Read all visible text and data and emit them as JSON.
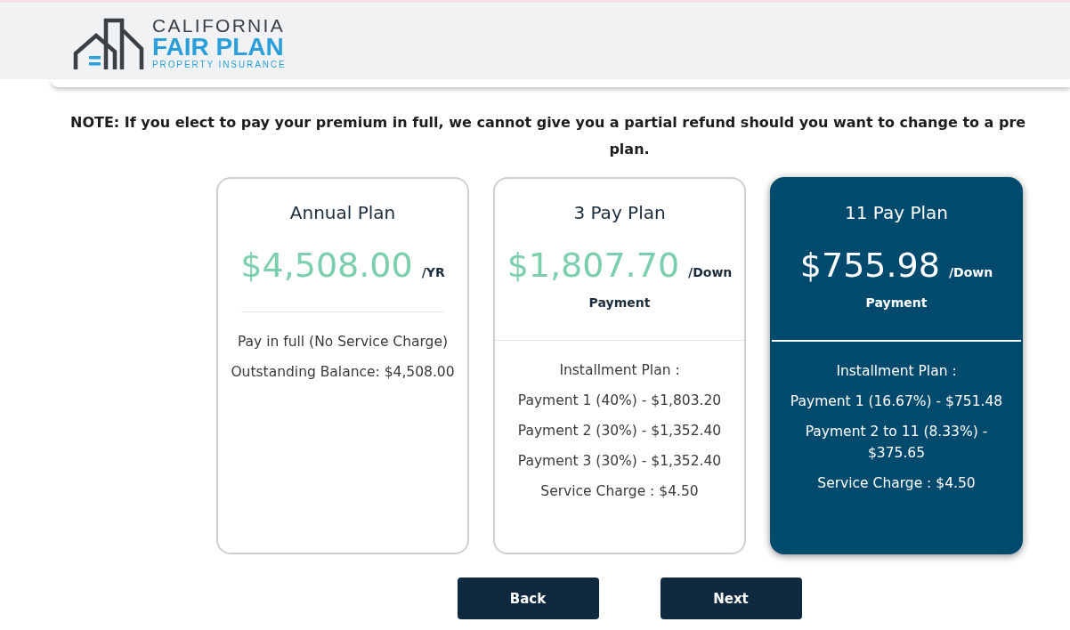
{
  "header": {
    "logo": {
      "line_1": "CALIFORNIA",
      "line_2": "FAIR PLAN",
      "line_3": "PROPERTY INSURANCE"
    }
  },
  "note": {
    "lines": [
      "NOTE: If you elect to pay your premium in full, we cannot give you a partial refund should you want to change to a pre",
      "plan."
    ]
  },
  "plans": [
    {
      "kind": "single",
      "title": "Annual Plan",
      "price": "$4,508.00",
      "unit_lines": [
        "/YR"
      ],
      "selected": false,
      "details": [
        "Pay in full (No Service Charge)",
        "Outstanding Balance: $4,508.00"
      ]
    },
    {
      "kind": "installment",
      "title": "3 Pay Plan",
      "price": "$1,807.70",
      "unit_lines": [
        "/Down",
        "Payment"
      ],
      "selected": false,
      "details": [
        "Installment Plan :",
        "Payment 1 (40%) - $1,803.20",
        "Payment 2 (30%) - $1,352.40",
        "Payment 3 (30%) - $1,352.40",
        "Service Charge : $4.50"
      ]
    },
    {
      "kind": "installment",
      "title": "11 Pay Plan",
      "price": "$755.98",
      "unit_lines": [
        "/Down",
        "Payment"
      ],
      "selected": true,
      "details": [
        "Installment Plan :",
        "Payment 1 (16.67%) - $751.48",
        "Payment 2 to 11 (8.33%) - $375.65",
        "Service Charge : $4.50"
      ]
    }
  ],
  "buttons": [
    {
      "label": "Back"
    },
    {
      "label": "Next"
    }
  ]
}
